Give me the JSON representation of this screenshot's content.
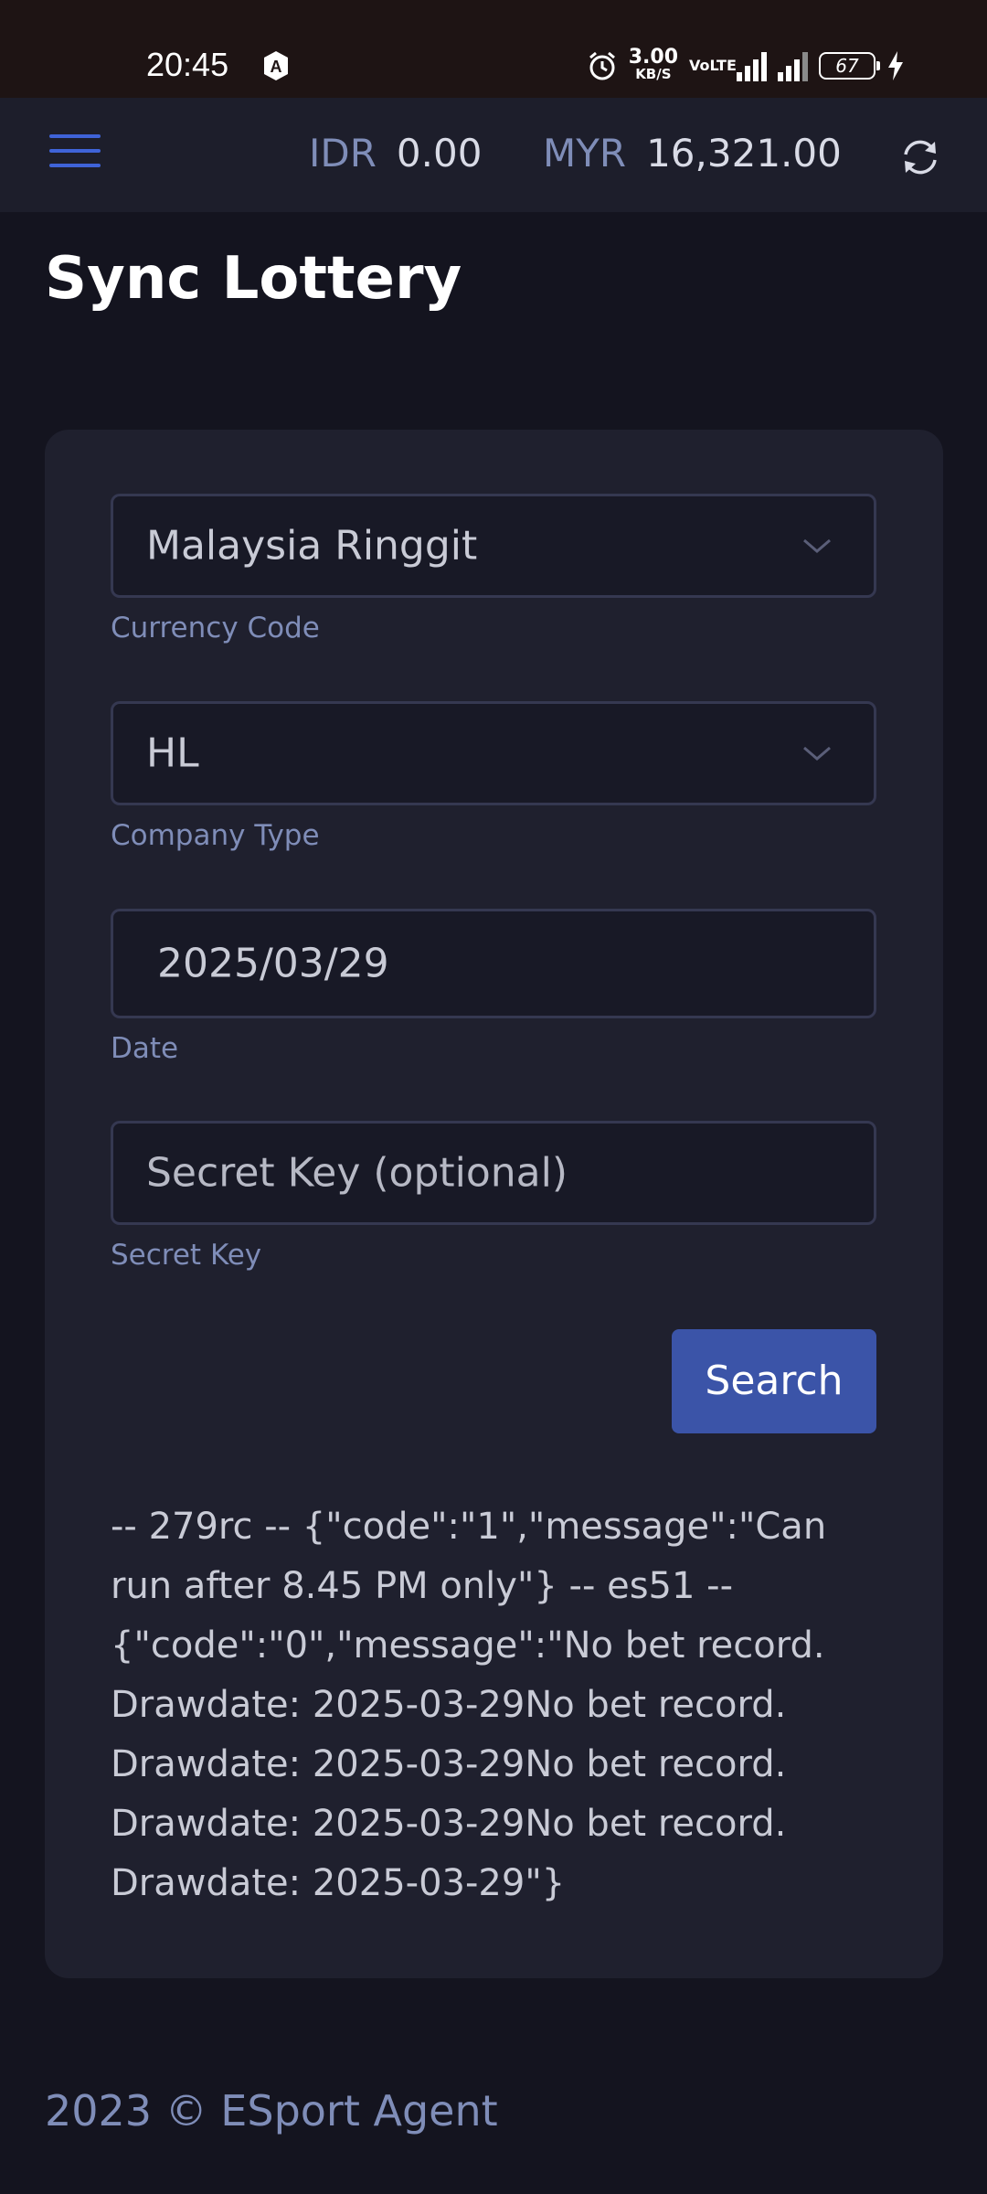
{
  "status_bar": {
    "time": "20:45",
    "net_speed": "3.00",
    "net_unit": "KB/S",
    "vo_lte": "VoLTE",
    "battery": "67",
    "icons": [
      "alarm-icon",
      "signal-icon",
      "battery-icon",
      "charging-icon"
    ]
  },
  "header": {
    "balances": [
      {
        "currency": "IDR",
        "amount": "0.00"
      },
      {
        "currency": "MYR",
        "amount": "16,321.00"
      }
    ]
  },
  "page": {
    "title": "Sync Lottery"
  },
  "form": {
    "currency": {
      "value": "Malaysia Ringgit",
      "label": "Currency Code"
    },
    "company": {
      "value": "HL",
      "label": "Company Type"
    },
    "date": {
      "value": "2025/03/29",
      "label": "Date"
    },
    "secret": {
      "placeholder": "Secret Key (optional)",
      "label": "Secret Key"
    },
    "search_label": "Search"
  },
  "result_text": "-- 279rc -- {\"code\":\"1\",\"message\":\"Can run after 8.45 PM only\"} -- es51 -- {\"code\":\"0\",\"message\":\"No bet record. Drawdate: 2025-03-29No bet record. Drawdate: 2025-03-29No bet record. Drawdate: 2025-03-29No bet record. Drawdate: 2025-03-29\"}",
  "footer": {
    "text": "2023 © ESport Agent"
  },
  "colors": {
    "background": "#14141f",
    "card": "#1f202e",
    "accent": "#3b54a8",
    "muted": "#7f8db8"
  }
}
